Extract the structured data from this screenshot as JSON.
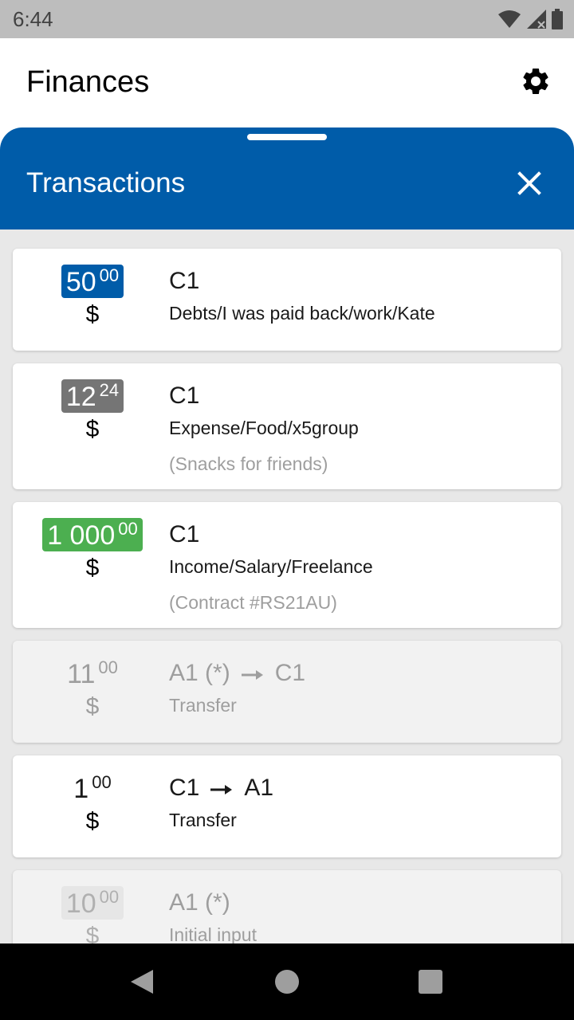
{
  "status_bar": {
    "time": "6:44",
    "icons": [
      "wifi-icon",
      "signal-icon",
      "battery-icon"
    ]
  },
  "app_bar": {
    "title": "Finances",
    "settings_icon": "gear-icon"
  },
  "sheet": {
    "title": "Transactions",
    "close_icon": "close-icon",
    "transactions": [
      {
        "amount_int": "50",
        "amount_frac": "00",
        "currency": "$",
        "account": "C1",
        "category": "Debts/I was paid back/work/Kate",
        "note": "",
        "badge_color": "#005ca9",
        "state": "normal"
      },
      {
        "amount_int": "12",
        "amount_frac": "24",
        "currency": "$",
        "account": "C1",
        "category": "Expense/Food/x5group",
        "note": "(Snacks for friends)",
        "badge_color": "#757575",
        "state": "normal"
      },
      {
        "amount_int": "1 000",
        "amount_frac": "00",
        "currency": "$",
        "account": "C1",
        "category": "Income/Salary/Freelance",
        "note": "(Contract #RS21AU)",
        "badge_color": "#4caf50",
        "state": "normal"
      },
      {
        "amount_int": "11",
        "amount_frac": "00",
        "currency": "$",
        "account_from": "A1 (*)",
        "account_to": "C1",
        "category": "Transfer",
        "note": "",
        "badge_color": "",
        "state": "dim"
      },
      {
        "amount_int": "1",
        "amount_frac": "00",
        "currency": "$",
        "account_from": "C1",
        "account_to": "A1",
        "category": "Transfer",
        "note": "",
        "badge_color": "",
        "state": "normal"
      },
      {
        "amount_int": "10",
        "amount_frac": "00",
        "currency": "$",
        "account": "A1 (*)",
        "category": "Initial input",
        "note": "",
        "badge_color": "#e6e6e6",
        "state": "dim"
      }
    ]
  },
  "nav_bar": {
    "icons": [
      "back-icon",
      "home-icon",
      "recents-icon"
    ]
  }
}
